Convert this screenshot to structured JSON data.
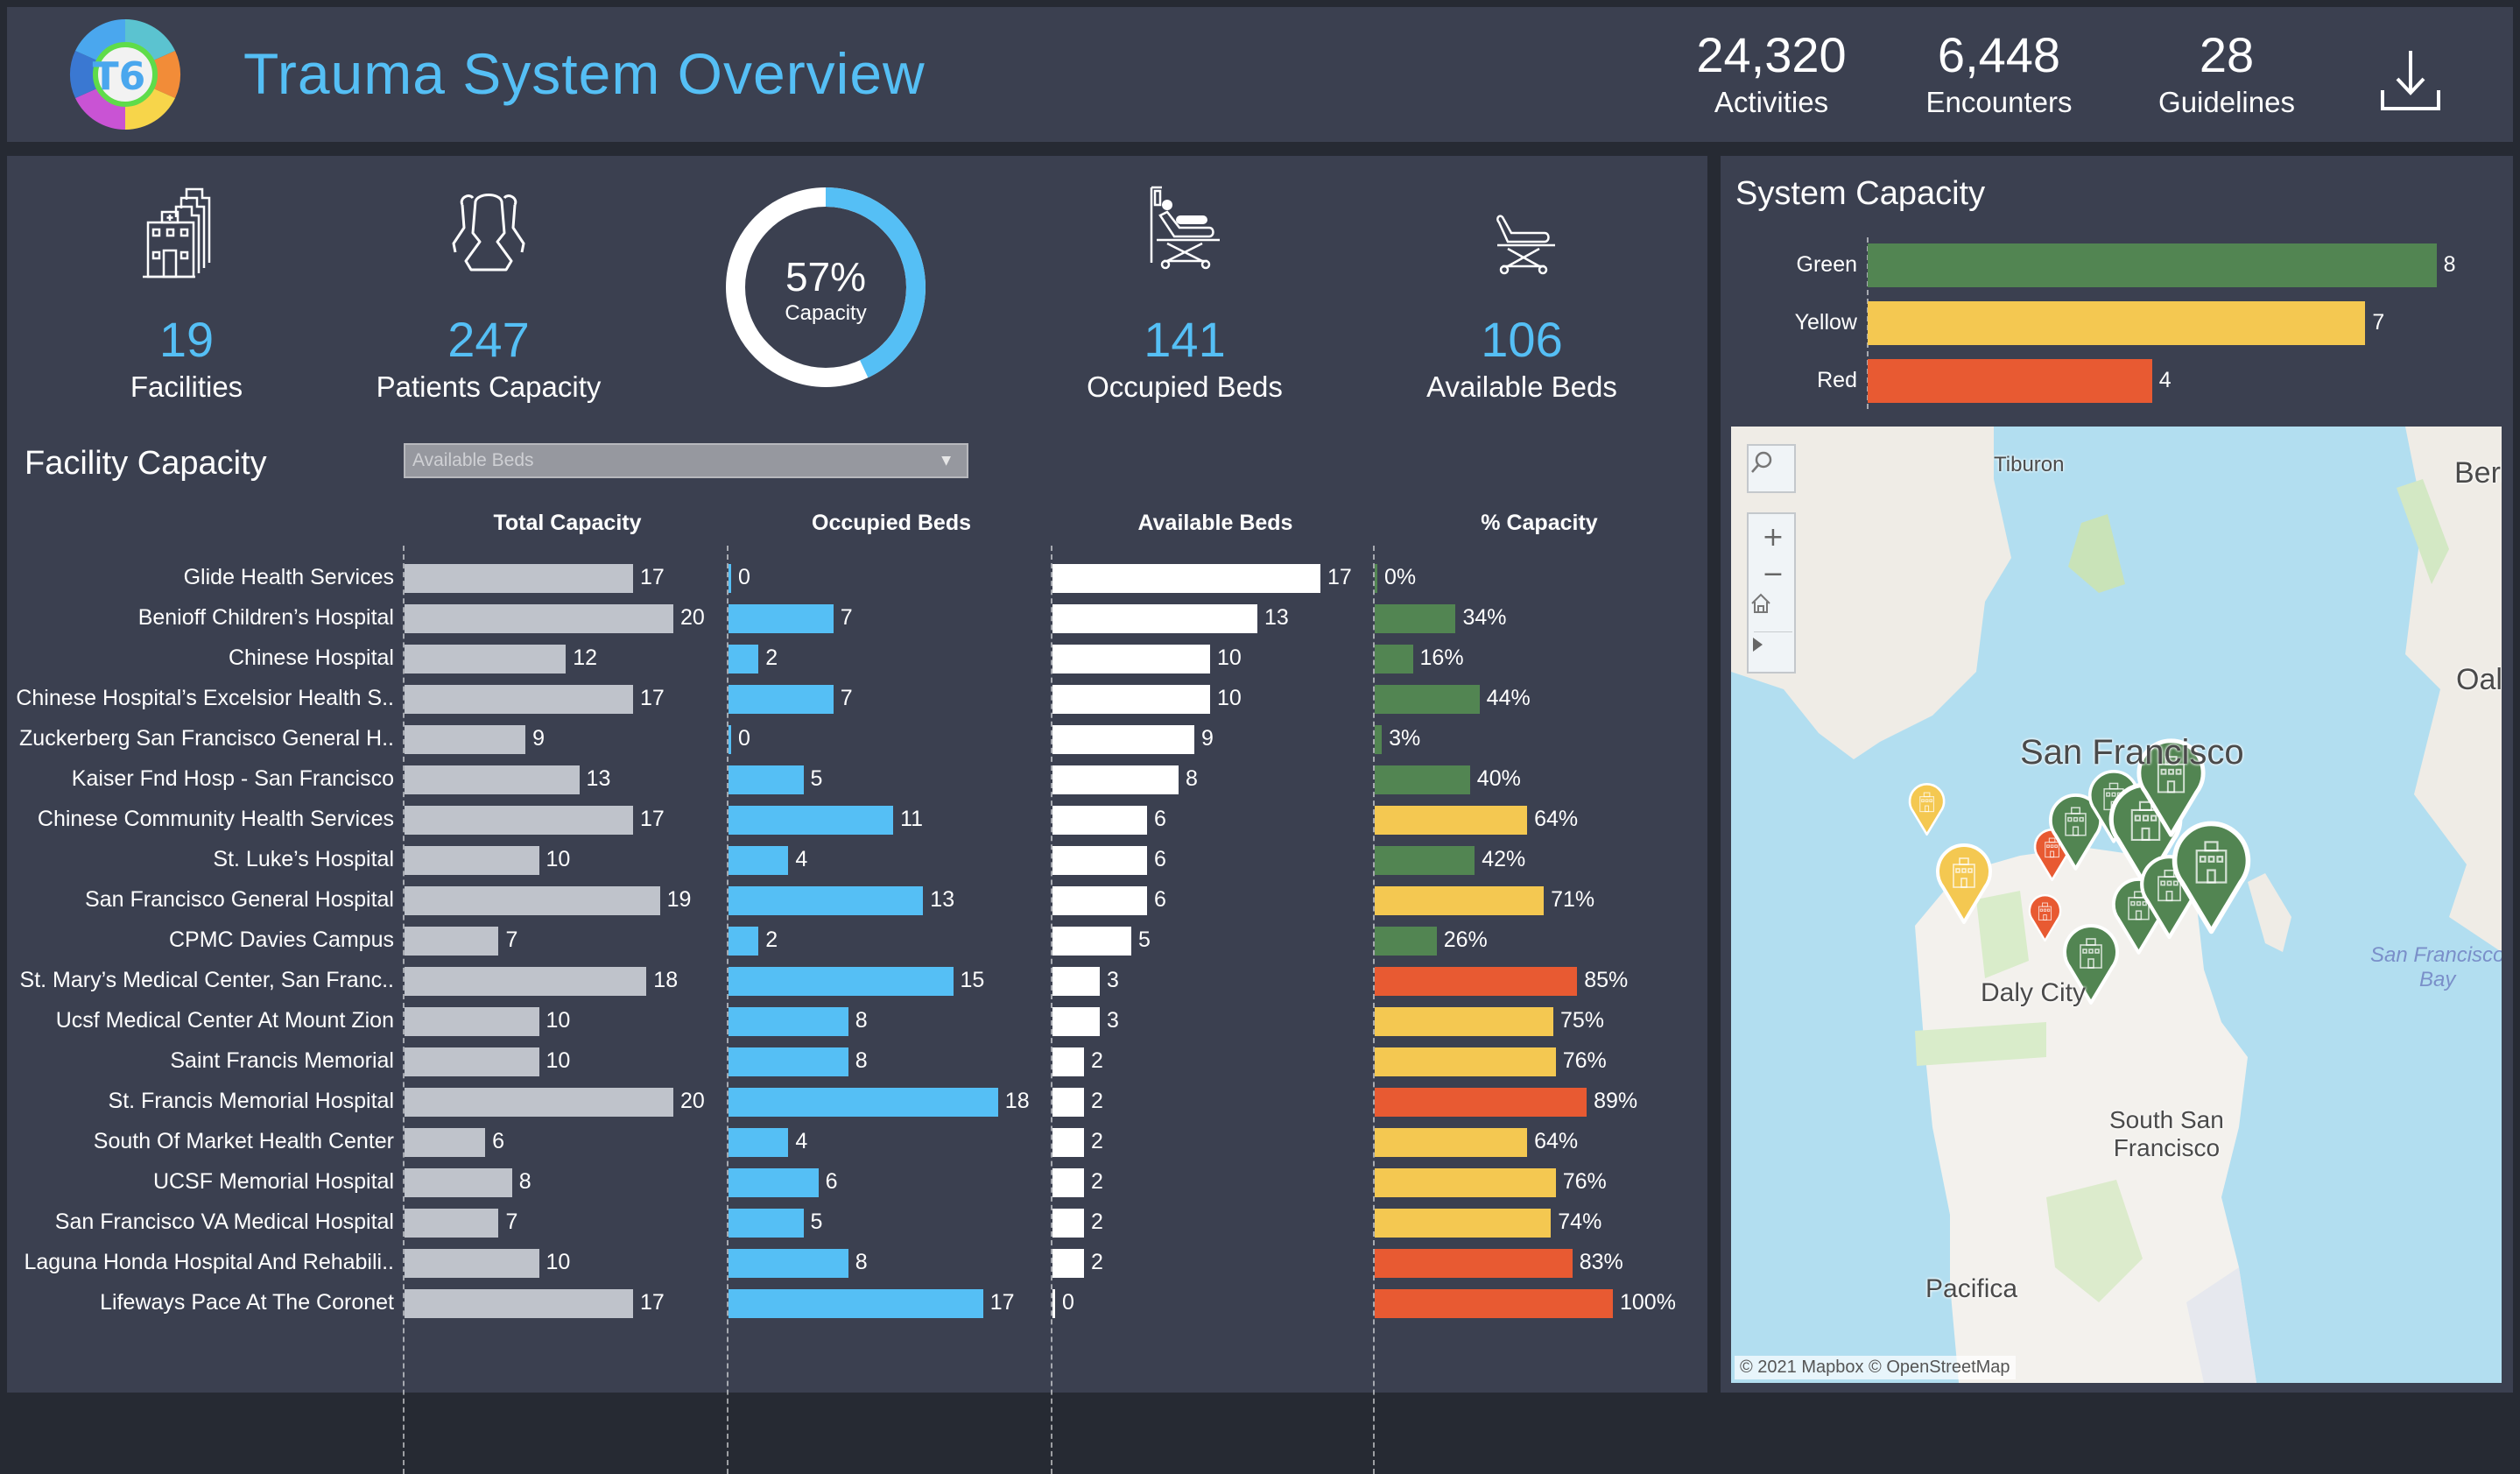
{
  "header": {
    "title": "Trauma System Overview",
    "logo_text": "T6",
    "stats": [
      {
        "value": "24,320",
        "label": "Activities"
      },
      {
        "value": "6,448",
        "label": "Encounters"
      },
      {
        "value": "28",
        "label": "Guidelines"
      }
    ],
    "download_icon": "download-icon"
  },
  "kpis": {
    "facilities": {
      "value": "19",
      "label": "Facilities",
      "icon": "hospital-buildings-icon"
    },
    "patients": {
      "value": "247",
      "label": "Patients Capacity",
      "icon": "patients-icon"
    },
    "capacity": {
      "value": "57%",
      "label": "Capacity",
      "ring_fraction": 0.43
    },
    "occupied": {
      "value": "141",
      "label": "Occupied Beds",
      "icon": "occupied-bed-icon"
    },
    "available": {
      "value": "106",
      "label": "Available Beds",
      "icon": "empty-bed-icon"
    }
  },
  "facility_capacity": {
    "title": "Facility Capacity",
    "sort_select": {
      "value": "Available Beds"
    },
    "columns": [
      "Total Capacity",
      "Occupied Beds",
      "Available Beds",
      "% Capacity"
    ],
    "rows": [
      {
        "name": "Glide Health Services",
        "total": 17,
        "occupied": 0,
        "available": 17,
        "pct": 0,
        "status": "green"
      },
      {
        "name": "Benioff Children’s Hospital",
        "total": 20,
        "occupied": 7,
        "available": 13,
        "pct": 34,
        "status": "green"
      },
      {
        "name": "Chinese Hospital",
        "total": 12,
        "occupied": 2,
        "available": 10,
        "pct": 16,
        "status": "green"
      },
      {
        "name": "Chinese Hospital’s Excelsior Health S..",
        "total": 17,
        "occupied": 7,
        "available": 10,
        "pct": 44,
        "status": "green"
      },
      {
        "name": "Zuckerberg San Francisco General H..",
        "total": 9,
        "occupied": 0,
        "available": 9,
        "pct": 3,
        "status": "green"
      },
      {
        "name": "Kaiser Fnd Hosp - San Francisco",
        "total": 13,
        "occupied": 5,
        "available": 8,
        "pct": 40,
        "status": "green"
      },
      {
        "name": "Chinese Community Health Services",
        "total": 17,
        "occupied": 11,
        "available": 6,
        "pct": 64,
        "status": "yellow"
      },
      {
        "name": "St. Luke’s Hospital",
        "total": 10,
        "occupied": 4,
        "available": 6,
        "pct": 42,
        "status": "green"
      },
      {
        "name": "San Francisco General Hospital",
        "total": 19,
        "occupied": 13,
        "available": 6,
        "pct": 71,
        "status": "yellow"
      },
      {
        "name": "CPMC Davies Campus",
        "total": 7,
        "occupied": 2,
        "available": 5,
        "pct": 26,
        "status": "green"
      },
      {
        "name": "St. Mary’s Medical Center, San Franc..",
        "total": 18,
        "occupied": 15,
        "available": 3,
        "pct": 85,
        "status": "red"
      },
      {
        "name": "Ucsf Medical Center At Mount Zion",
        "total": 10,
        "occupied": 8,
        "available": 3,
        "pct": 75,
        "status": "yellow"
      },
      {
        "name": "Saint Francis Memorial",
        "total": 10,
        "occupied": 8,
        "available": 2,
        "pct": 76,
        "status": "yellow"
      },
      {
        "name": "St. Francis Memorial Hospital",
        "total": 20,
        "occupied": 18,
        "available": 2,
        "pct": 89,
        "status": "red"
      },
      {
        "name": "South Of Market Health Center",
        "total": 6,
        "occupied": 4,
        "available": 2,
        "pct": 64,
        "status": "yellow"
      },
      {
        "name": "UCSF Memorial Hospital",
        "total": 8,
        "occupied": 6,
        "available": 2,
        "pct": 76,
        "status": "yellow"
      },
      {
        "name": "San Francisco VA Medical Hospital",
        "total": 7,
        "occupied": 5,
        "available": 2,
        "pct": 74,
        "status": "yellow"
      },
      {
        "name": "Laguna Honda Hospital And Rehabili..",
        "total": 10,
        "occupied": 8,
        "available": 2,
        "pct": 83,
        "status": "red"
      },
      {
        "name": "Lifeways Pace At The Coronet",
        "total": 17,
        "occupied": 17,
        "available": 0,
        "pct": 100,
        "status": "red"
      }
    ]
  },
  "system_capacity": {
    "title": "System Capacity",
    "bars": [
      {
        "label": "Green",
        "value": 8,
        "status": "green"
      },
      {
        "label": "Yellow",
        "value": 7,
        "status": "yellow"
      },
      {
        "label": "Red",
        "value": 4,
        "status": "red"
      }
    ]
  },
  "map": {
    "labels": {
      "tiburon": "Tiburon",
      "berkeley": "Berl",
      "oakland": "Oal",
      "sf": "San Francisco",
      "sf_bay_1": "San Francisco",
      "sf_bay_2": "Bay",
      "daly_city": "Daly City",
      "ssf_1": "South San",
      "ssf_2": "Francisco",
      "pacifica": "Pacifica"
    },
    "attribution": "© 2021 Mapbox  © OpenStreetMap",
    "controls": [
      "search",
      "zoom-in",
      "zoom-out",
      "home",
      "expand"
    ],
    "markers": [
      {
        "status": "yellow"
      },
      {
        "status": "red"
      },
      {
        "status": "green"
      },
      {
        "status": "green"
      },
      {
        "status": "green"
      },
      {
        "status": "green"
      },
      {
        "status": "yellow"
      },
      {
        "status": "red"
      },
      {
        "status": "green"
      },
      {
        "status": "green"
      },
      {
        "status": "green"
      },
      {
        "status": "green"
      }
    ]
  },
  "colors": {
    "accent": "#55bff5",
    "green": "#528552",
    "yellow": "#f4c851",
    "red": "#e85a32",
    "total_bar": "#bfc3cb",
    "occupied_bar": "#55bff5",
    "available_bar": "#ffffff",
    "panel": "#3b4050",
    "background": "#262a33"
  }
}
